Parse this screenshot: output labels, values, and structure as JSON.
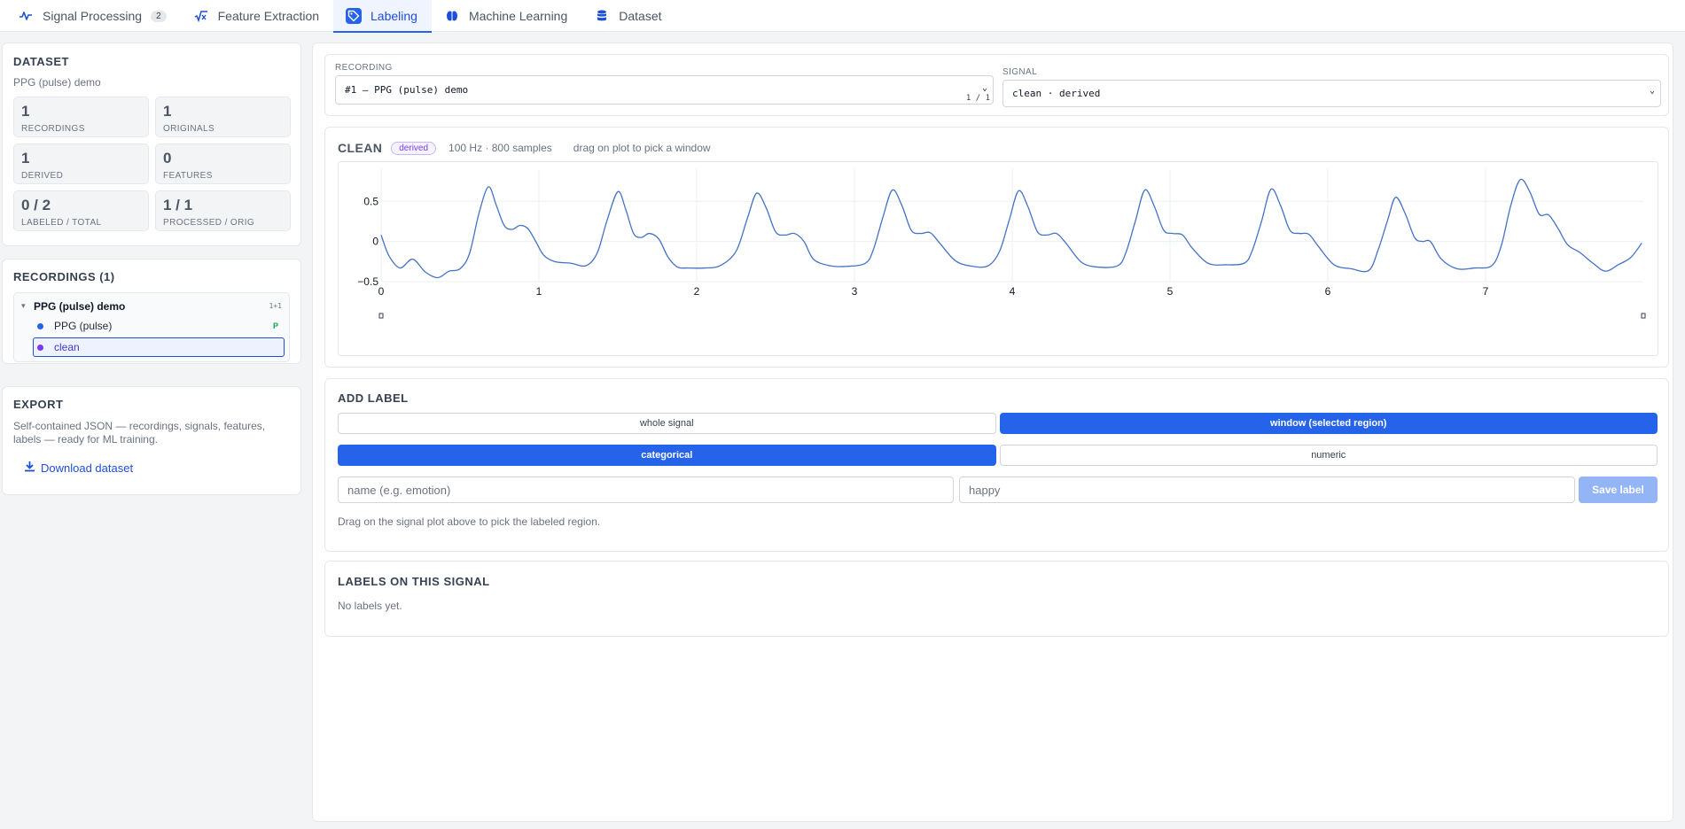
{
  "tabs": [
    {
      "label": "Signal Processing",
      "icon": "waveform-icon",
      "badge": "2",
      "active": false
    },
    {
      "label": "Feature Extraction",
      "icon": "sqrt-x-icon",
      "badge": "",
      "active": false
    },
    {
      "label": "Labeling",
      "icon": "tag-icon",
      "badge": "",
      "active": true
    },
    {
      "label": "Machine Learning",
      "icon": "brain-icon",
      "badge": "",
      "active": false
    },
    {
      "label": "Dataset",
      "icon": "database-icon",
      "badge": "",
      "active": false
    }
  ],
  "sidebar": {
    "dataset": {
      "title": "DATASET",
      "name": "PPG (pulse) demo",
      "stats": [
        {
          "value": "1",
          "label": "RECORDINGS"
        },
        {
          "value": "1",
          "label": "ORIGINALS"
        },
        {
          "value": "1",
          "label": "DERIVED"
        },
        {
          "value": "0",
          "label": "FEATURES"
        },
        {
          "value": "0 / 2",
          "label": "LABELED / TOTAL"
        },
        {
          "value": "1 / 1",
          "label": "PROCESSED / ORIG"
        }
      ]
    },
    "recordings": {
      "title": "RECORDINGS (1)",
      "group_name": "PPG (pulse) demo",
      "group_count": "1+1",
      "signals": [
        {
          "name": "PPG (pulse)",
          "flag": "P",
          "color": "#2563eb",
          "selected": false
        },
        {
          "name": "clean",
          "flag": "",
          "color": "#7c3aed",
          "selected": true
        }
      ]
    },
    "export": {
      "title": "EXPORT",
      "description": "Self-contained JSON — recordings, signals, features, labels — ready for ML training.",
      "download_label": "Download dataset"
    }
  },
  "selectors": {
    "recording_label": "RECORDING",
    "recording_value": "#1 — PPG (pulse) demo",
    "recording_counter": "1 / 1",
    "signal_label": "SIGNAL",
    "signal_value": "clean · derived"
  },
  "plot": {
    "title": "CLEAN",
    "badge": "derived",
    "meta": "100 Hz · 800 samples",
    "hint": "drag on plot to pick a window"
  },
  "chart_data": {
    "type": "line",
    "x_range": [
      0,
      8
    ],
    "ylim": [
      -0.5,
      0.9
    ],
    "x_ticks": [
      "0",
      "1",
      "2",
      "3",
      "4",
      "5",
      "6",
      "7"
    ],
    "y_ticks": [
      "0.5",
      "0",
      "−0.5"
    ],
    "grid": true,
    "series": [
      {
        "color": "#4472c4",
        "x": [
          0,
          0.05,
          0.12,
          0.2,
          0.28,
          0.36,
          0.43,
          0.5,
          0.56,
          0.62,
          0.68,
          0.73,
          0.78,
          0.83,
          0.88,
          0.93,
          0.98,
          1.03,
          1.1,
          1.2,
          1.3,
          1.37,
          1.43,
          1.5,
          1.55,
          1.6,
          1.65,
          1.7,
          1.76,
          1.82,
          1.88,
          1.94,
          2.05,
          2.15,
          2.25,
          2.32,
          2.38,
          2.44,
          2.5,
          2.56,
          2.62,
          2.68,
          2.74,
          2.84,
          2.95,
          3.07,
          3.12,
          3.18,
          3.24,
          3.3,
          3.36,
          3.42,
          3.48,
          3.54,
          3.64,
          3.75,
          3.85,
          3.92,
          3.98,
          4.04,
          4.1,
          4.16,
          4.22,
          4.28,
          4.34,
          4.44,
          4.55,
          4.67,
          4.72,
          4.78,
          4.84,
          4.9,
          4.96,
          5.02,
          5.08,
          5.14,
          5.24,
          5.35,
          5.47,
          5.52,
          5.58,
          5.64,
          5.7,
          5.76,
          5.82,
          5.88,
          5.94,
          6.04,
          6.15,
          6.26,
          6.32,
          6.38,
          6.43,
          6.49,
          6.55,
          6.6,
          6.65,
          6.72,
          6.82,
          6.93,
          7.04,
          7.1,
          7.16,
          7.22,
          7.28,
          7.34,
          7.4,
          7.46,
          7.52,
          7.6,
          7.68,
          7.76,
          7.84,
          7.92,
          7.99
        ],
        "y": [
          0.08,
          -0.18,
          -0.33,
          -0.22,
          -0.38,
          -0.45,
          -0.37,
          -0.34,
          -0.15,
          0.35,
          0.68,
          0.45,
          0.2,
          0.15,
          0.2,
          0.16,
          0.0,
          -0.17,
          -0.25,
          -0.27,
          -0.3,
          -0.14,
          0.25,
          0.62,
          0.4,
          0.1,
          0.05,
          0.1,
          0.03,
          -0.2,
          -0.32,
          -0.33,
          -0.33,
          -0.3,
          -0.12,
          0.28,
          0.6,
          0.42,
          0.12,
          0.08,
          0.1,
          0.0,
          -0.22,
          -0.3,
          -0.31,
          -0.27,
          -0.1,
          0.3,
          0.64,
          0.45,
          0.14,
          0.1,
          0.11,
          -0.02,
          -0.24,
          -0.31,
          -0.3,
          -0.12,
          0.26,
          0.63,
          0.43,
          0.12,
          0.08,
          0.1,
          -0.02,
          -0.26,
          -0.32,
          -0.3,
          -0.14,
          0.25,
          0.64,
          0.44,
          0.14,
          0.1,
          0.08,
          -0.08,
          -0.27,
          -0.29,
          -0.27,
          -0.12,
          0.25,
          0.65,
          0.45,
          0.14,
          0.1,
          0.09,
          -0.06,
          -0.29,
          -0.34,
          -0.36,
          -0.1,
          0.27,
          0.55,
          0.35,
          0.05,
          0.0,
          0.0,
          -0.22,
          -0.34,
          -0.33,
          -0.3,
          -0.05,
          0.45,
          0.77,
          0.62,
          0.34,
          0.33,
          0.16,
          -0.04,
          -0.14,
          -0.27,
          -0.37,
          -0.29,
          -0.2,
          -0.02
        ]
      }
    ]
  },
  "add_label": {
    "title": "ADD LABEL",
    "scope_options": [
      "whole signal",
      "window (selected region)"
    ],
    "scope_selected": 1,
    "kind_options": [
      "categorical",
      "numeric"
    ],
    "kind_selected": 0,
    "name_placeholder": "name (e.g. emotion)",
    "value_placeholder": "happy",
    "save_label": "Save label",
    "hint": "Drag on the signal plot above to pick the labeled region."
  },
  "labels_list": {
    "title": "LABELS ON THIS SIGNAL",
    "empty_text": "No labels yet."
  }
}
